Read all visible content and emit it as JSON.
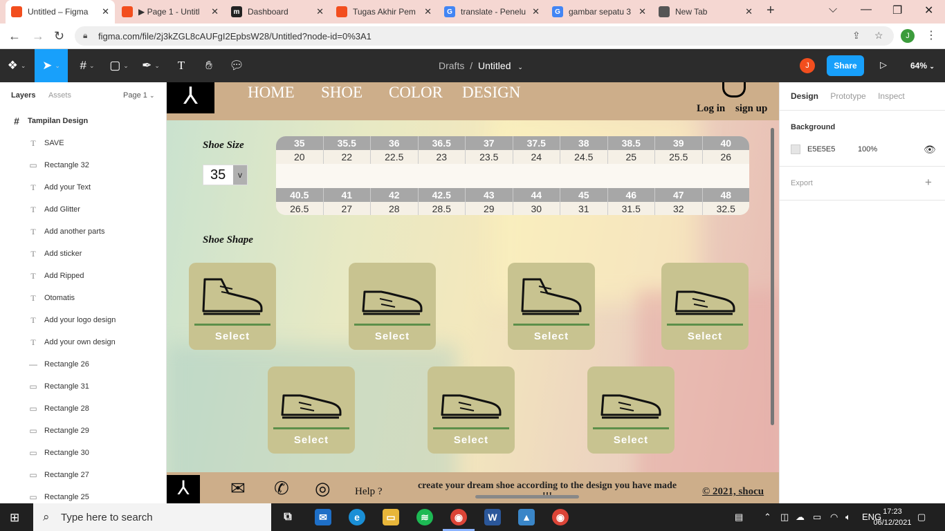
{
  "browser": {
    "tabs": [
      {
        "label": "Untitled – Figma",
        "favicon": "figma-icon",
        "color": "#f24e1e",
        "active": true
      },
      {
        "label": "▶ Page 1 - Untitl",
        "favicon": "figma-icon",
        "color": "#f24e1e"
      },
      {
        "label": "Dashboard",
        "favicon": "m-icon",
        "color": "#222222"
      },
      {
        "label": "Tugas Akhir Pem",
        "favicon": "figma-icon",
        "color": "#f24e1e"
      },
      {
        "label": "translate - Penelu",
        "favicon": "google-icon",
        "color": "#4285f4"
      },
      {
        "label": "gambar sepatu 3",
        "favicon": "google-icon",
        "color": "#4285f4"
      },
      {
        "label": "New Tab",
        "favicon": "chrome-icon",
        "color": "#555555"
      }
    ],
    "url": "figma.com/file/2j3kZGL8cAUFgI2EpbsW28/Untitled?node-id=0%3A1",
    "profile_initial": "J"
  },
  "figma": {
    "breadcrumb_parent": "Drafts",
    "file_name": "Untitled",
    "user_initial": "J",
    "share_label": "Share",
    "zoom": "64%"
  },
  "left_panel": {
    "tab_layers": "Layers",
    "tab_assets": "Assets",
    "page": "Page 1",
    "frame": "Tampilan Design",
    "layers": [
      {
        "type": "text",
        "name": "SAVE"
      },
      {
        "type": "rect",
        "name": "Rectangle 32"
      },
      {
        "type": "text",
        "name": "Add your Text"
      },
      {
        "type": "text",
        "name": "Add Glitter"
      },
      {
        "type": "text",
        "name": "Add another parts"
      },
      {
        "type": "text",
        "name": "Add sticker"
      },
      {
        "type": "text",
        "name": "Add Ripped"
      },
      {
        "type": "text",
        "name": "Otomatis"
      },
      {
        "type": "text",
        "name": "Add your logo design"
      },
      {
        "type": "text",
        "name": "Add your own design"
      },
      {
        "type": "line",
        "name": "Rectangle 26"
      },
      {
        "type": "rect",
        "name": "Rectangle 31"
      },
      {
        "type": "rect",
        "name": "Rectangle 28"
      },
      {
        "type": "rect",
        "name": "Rectangle 29"
      },
      {
        "type": "rect",
        "name": "Rectangle 30"
      },
      {
        "type": "rect",
        "name": "Rectangle 27"
      },
      {
        "type": "rect",
        "name": "Rectangle 25"
      }
    ]
  },
  "right_panel": {
    "tab_design": "Design",
    "tab_prototype": "Prototype",
    "tab_inspect": "Inspect",
    "background_label": "Background",
    "bg_hex": "E5E5E5",
    "bg_opacity": "100%",
    "export_label": "Export"
  },
  "site": {
    "logo": "⅄",
    "nav": [
      "HOME",
      "SHOE",
      "COLOR",
      "DESIGN"
    ],
    "login": "Log in",
    "signup": "sign up",
    "shoe_size_title": "Shoe Size",
    "selected_size": "35",
    "dropdown_glyph": "v",
    "size_rows": [
      {
        "eu": [
          "35",
          "35.5",
          "36",
          "36.5",
          "37",
          "37.5",
          "38",
          "38.5",
          "39",
          "40"
        ],
        "cm": [
          "20",
          "22",
          "22.5",
          "23",
          "23.5",
          "24",
          "24.5",
          "25",
          "25.5",
          "26"
        ]
      },
      {
        "eu": [
          "40.5",
          "41",
          "42",
          "42.5",
          "43",
          "44",
          "45",
          "46",
          "47",
          "48"
        ],
        "cm": [
          "26.5",
          "27",
          "28",
          "28.5",
          "29",
          "30",
          "31",
          "31.5",
          "32",
          "32.5"
        ]
      }
    ],
    "shoe_shape_title": "Shoe Shape",
    "select_label": "Select",
    "help": "Help ?",
    "footer_message": "create your dream shoe according to the design you have made !!!",
    "copyright": "© 2021, shocu"
  },
  "taskbar": {
    "search_placeholder": "Type here to search",
    "time": "17:23",
    "date": "06/12/2021"
  }
}
